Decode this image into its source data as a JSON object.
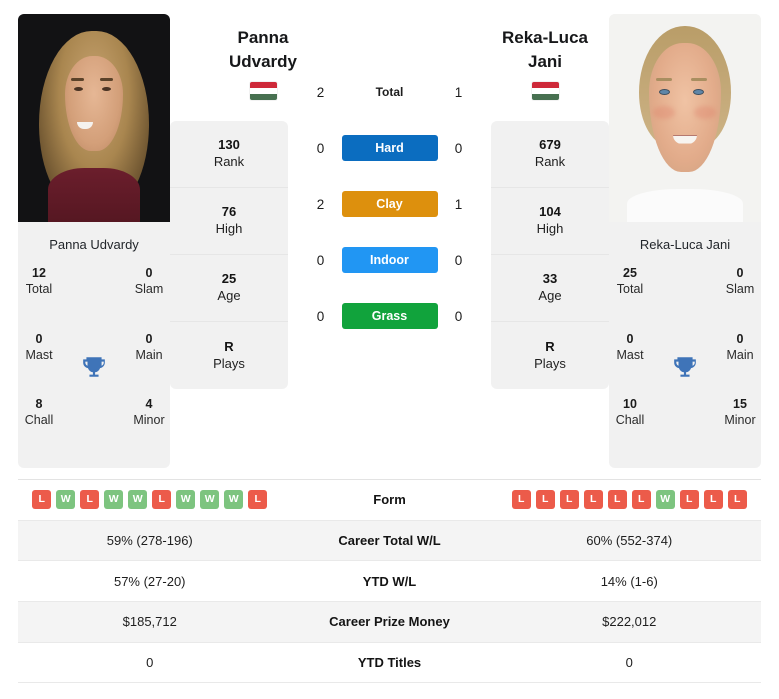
{
  "players": {
    "left": {
      "first_name": "Panna",
      "last_name": "Udvardy",
      "full_name": "Panna Udvardy",
      "country": "Hungary",
      "flag_colors": [
        "#ce2939",
        "#ffffff",
        "#477050"
      ],
      "photo_alt": "Panna Udvardy portrait",
      "stats": [
        {
          "value": "130",
          "key": "Rank"
        },
        {
          "value": "76",
          "key": "High"
        },
        {
          "value": "25",
          "key": "Age"
        },
        {
          "value": "R",
          "key": "Plays"
        }
      ],
      "titles": [
        {
          "value": "12",
          "key": "Total"
        },
        {
          "value": "0",
          "key": "Slam"
        },
        {
          "value": "0",
          "key": "Mast"
        },
        {
          "value": "0",
          "key": "Main"
        },
        {
          "value": "8",
          "key": "Chall"
        },
        {
          "value": "4",
          "key": "Minor"
        }
      ],
      "form": [
        "L",
        "W",
        "L",
        "W",
        "W",
        "L",
        "W",
        "W",
        "W",
        "L"
      ],
      "career_total_wl": "59% (278-196)",
      "ytd_wl": "57% (27-20)",
      "career_prize_money": "$185,712",
      "ytd_titles": "0"
    },
    "right": {
      "first_name": "Reka-Luca",
      "last_name": "Jani",
      "full_name": "Reka-Luca Jani",
      "country": "Hungary",
      "flag_colors": [
        "#ce2939",
        "#ffffff",
        "#477050"
      ],
      "photo_alt": "Reka-Luca Jani portrait",
      "stats": [
        {
          "value": "679",
          "key": "Rank"
        },
        {
          "value": "104",
          "key": "High"
        },
        {
          "value": "33",
          "key": "Age"
        },
        {
          "value": "R",
          "key": "Plays"
        }
      ],
      "titles": [
        {
          "value": "25",
          "key": "Total"
        },
        {
          "value": "0",
          "key": "Slam"
        },
        {
          "value": "0",
          "key": "Mast"
        },
        {
          "value": "0",
          "key": "Main"
        },
        {
          "value": "10",
          "key": "Chall"
        },
        {
          "value": "15",
          "key": "Minor"
        }
      ],
      "form": [
        "L",
        "L",
        "L",
        "L",
        "L",
        "L",
        "W",
        "L",
        "L",
        "L"
      ],
      "career_total_wl": "60% (552-374)",
      "ytd_wl": "14% (1-6)",
      "career_prize_money": "$222,012",
      "ytd_titles": "0"
    }
  },
  "head_to_head": {
    "rows": [
      {
        "label": "Total",
        "left": "2",
        "right": "1",
        "type": "total",
        "color": ""
      },
      {
        "label": "Hard",
        "left": "0",
        "right": "0",
        "type": "pill",
        "color": "#0b6dc0"
      },
      {
        "label": "Clay",
        "left": "2",
        "right": "1",
        "type": "pill",
        "color": "#dd900d"
      },
      {
        "label": "Indoor",
        "left": "0",
        "right": "0",
        "type": "pill",
        "color": "#2196f3"
      },
      {
        "label": "Grass",
        "left": "0",
        "right": "0",
        "type": "pill",
        "color": "#11a33c"
      }
    ]
  },
  "comparison_table": {
    "rows": [
      {
        "label": "Form",
        "kind": "form"
      },
      {
        "label": "Career Total W/L",
        "kind": "text",
        "field": "career_total_wl"
      },
      {
        "label": "YTD W/L",
        "kind": "text",
        "field": "ytd_wl"
      },
      {
        "label": "Career Prize Money",
        "kind": "text",
        "field": "career_prize_money"
      },
      {
        "label": "YTD Titles",
        "kind": "text",
        "field": "ytd_titles"
      }
    ]
  },
  "theme": {
    "panel_bg": "#f1f1f1",
    "row_alt_bg": "#f4f4f4",
    "win_color": "#7dc47f",
    "loss_color": "#ec5b4a",
    "trophy_color": "#3f74b8"
  }
}
